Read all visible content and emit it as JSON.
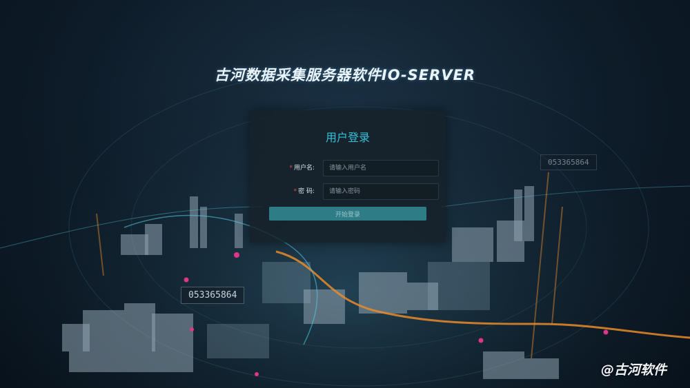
{
  "app": {
    "title": "古河数据采集服务器软件IO-SERVER"
  },
  "login": {
    "heading": "用户登录",
    "username": {
      "label": "用户名:",
      "placeholder": "请输入用户名"
    },
    "password": {
      "label": "密 码:",
      "placeholder": "请输入密码"
    },
    "submit_label": "开始登录",
    "required_mark": "*"
  },
  "background": {
    "tag_big": "053365864",
    "tag_small": "053365864"
  },
  "watermark": "@古河软件",
  "colors": {
    "accent": "#33c2d8",
    "button": "#2e7d86",
    "required": "#e05050",
    "orange_road": "#e98b2a"
  }
}
